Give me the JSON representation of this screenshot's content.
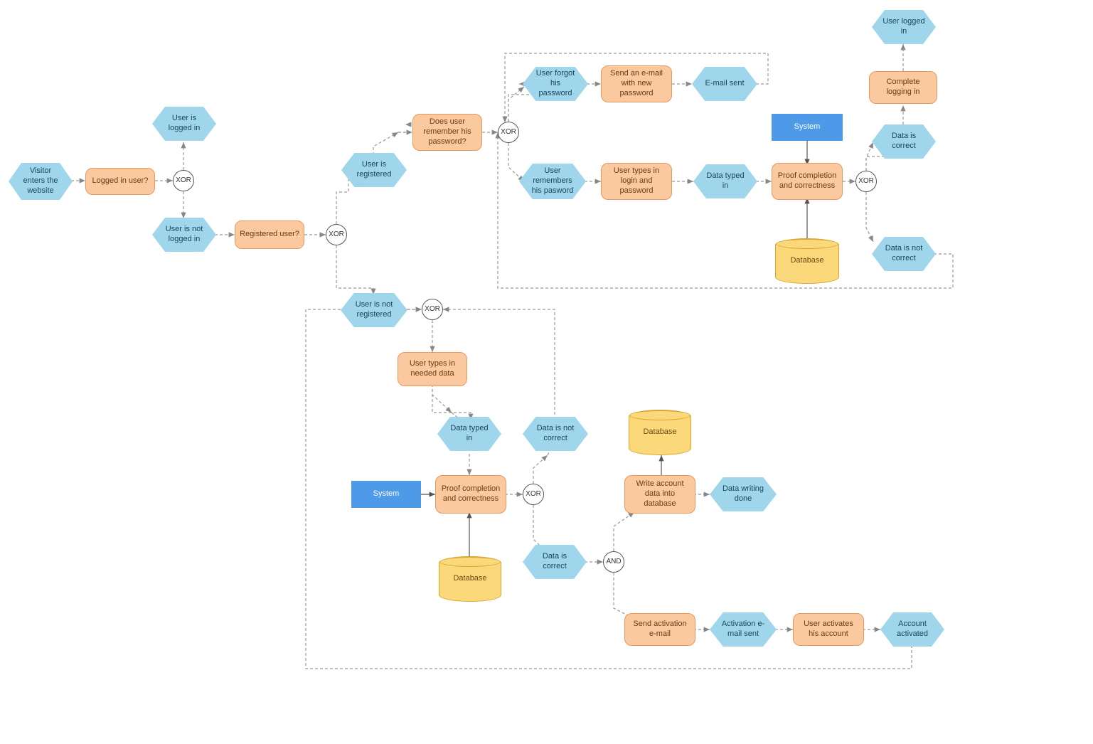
{
  "nodes": {
    "visitor": {
      "label": "Visitor enters the website"
    },
    "loggedInUser": {
      "label": "Logged in user?"
    },
    "xor1": {
      "label": "XOR"
    },
    "isLogged": {
      "label": "User is logged in"
    },
    "notLogged": {
      "label": "User is not logged in"
    },
    "registeredUser": {
      "label": "Registered user?"
    },
    "xor2": {
      "label": "XOR"
    },
    "isRegistered": {
      "label": "User is registered"
    },
    "notRegistered": {
      "label": "User is not registered"
    },
    "xor3": {
      "label": "XOR"
    },
    "remPassword": {
      "label": "Does user remember his password?"
    },
    "xor4": {
      "label": "XOR"
    },
    "forgotPwd": {
      "label": "User forgot his password"
    },
    "sendEmail": {
      "label": "Send an e-mail with new password"
    },
    "emailSent": {
      "label": "E-mail sent"
    },
    "remembers": {
      "label": "User remembers his pasword"
    },
    "typesLogin": {
      "label": "User types in login and password"
    },
    "dataTyped1": {
      "label": "Data typed in"
    },
    "proof1": {
      "label": "Proof completion and correctness"
    },
    "system1": {
      "label": "System"
    },
    "db1": {
      "label": "Database"
    },
    "xor5": {
      "label": "XOR"
    },
    "dataCorrect1": {
      "label": "Data is correct"
    },
    "completeLogin": {
      "label": "Complete logging in"
    },
    "userLoggedIn": {
      "label": "User logged in"
    },
    "dataNotCorrect1": {
      "label": "Data is not correct"
    },
    "typesNeeded": {
      "label": "User types in needed data"
    },
    "dataTyped2": {
      "label": "Data typed in"
    },
    "system2": {
      "label": "System"
    },
    "proof2": {
      "label": "Proof completion and correctness"
    },
    "db2": {
      "label": "Database"
    },
    "xor6": {
      "label": "XOR"
    },
    "dataNotCorrect2": {
      "label": "Data is not correct"
    },
    "dataCorrect2": {
      "label": "Data is correct"
    },
    "and1": {
      "label": "AND"
    },
    "writeAcct": {
      "label": "Write account data into database"
    },
    "db3": {
      "label": "Database"
    },
    "dataWriting": {
      "label": "Data writing done"
    },
    "sendActivation": {
      "label": "Send activation e-mail"
    },
    "activationSent": {
      "label": "Activation e-mail sent"
    },
    "userActivates": {
      "label": "User activates his account"
    },
    "acctActivated": {
      "label": "Account activated"
    }
  }
}
